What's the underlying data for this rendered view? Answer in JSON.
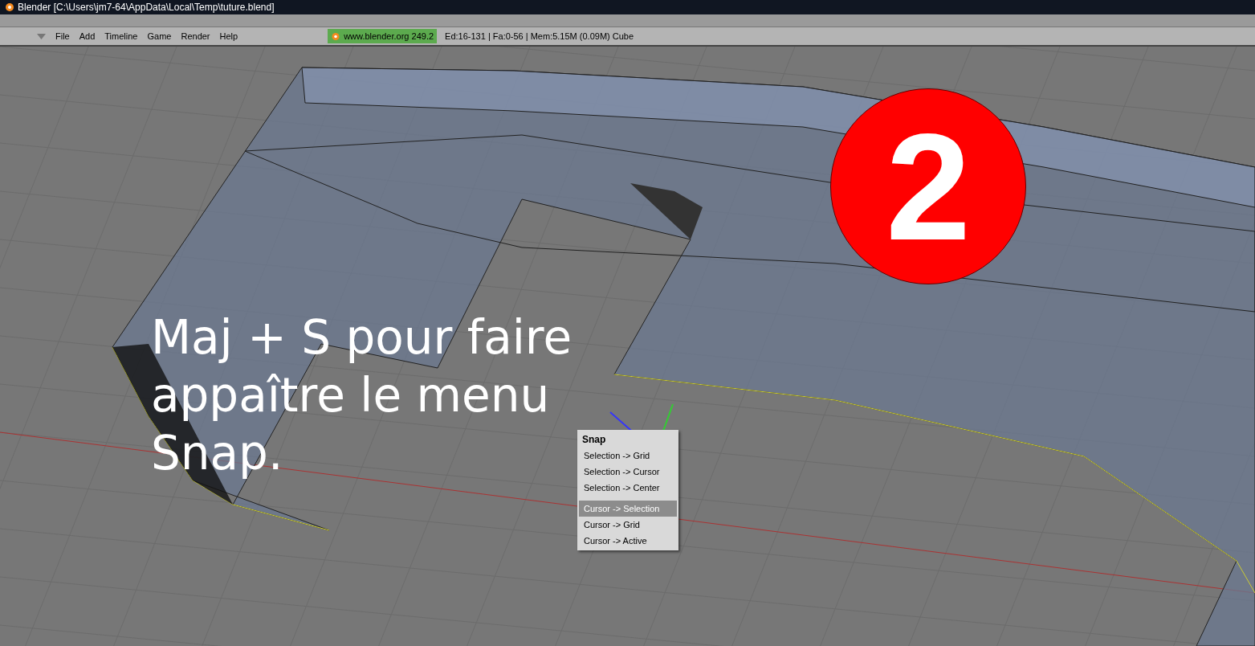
{
  "window": {
    "title": "Blender [C:\\Users\\jm7-64\\AppData\\Local\\Temp\\tuture.blend]"
  },
  "menu_bar": {
    "items": [
      "File",
      "Add",
      "Timeline",
      "Game",
      "Render",
      "Help"
    ]
  },
  "info": {
    "version": "www.blender.org 249.2",
    "stats": "Ed:16-131 | Fa:0-56 | Mem:5.15M (0.09M) Cube"
  },
  "caption": {
    "lines": [
      "Maj + S pour faire",
      "appaître le menu",
      "Snap."
    ]
  },
  "step_badge": "2",
  "snap_menu": {
    "title": "Snap",
    "groups": [
      [
        {
          "label": "Selection -> Grid",
          "selected": false
        },
        {
          "label": "Selection -> Cursor",
          "selected": false
        },
        {
          "label": "Selection -> Center",
          "selected": false
        }
      ],
      [
        {
          "label": "Cursor -> Selection",
          "selected": true
        },
        {
          "label": "Cursor -> Grid",
          "selected": false
        },
        {
          "label": "Cursor -> Active",
          "selected": false
        }
      ]
    ]
  }
}
